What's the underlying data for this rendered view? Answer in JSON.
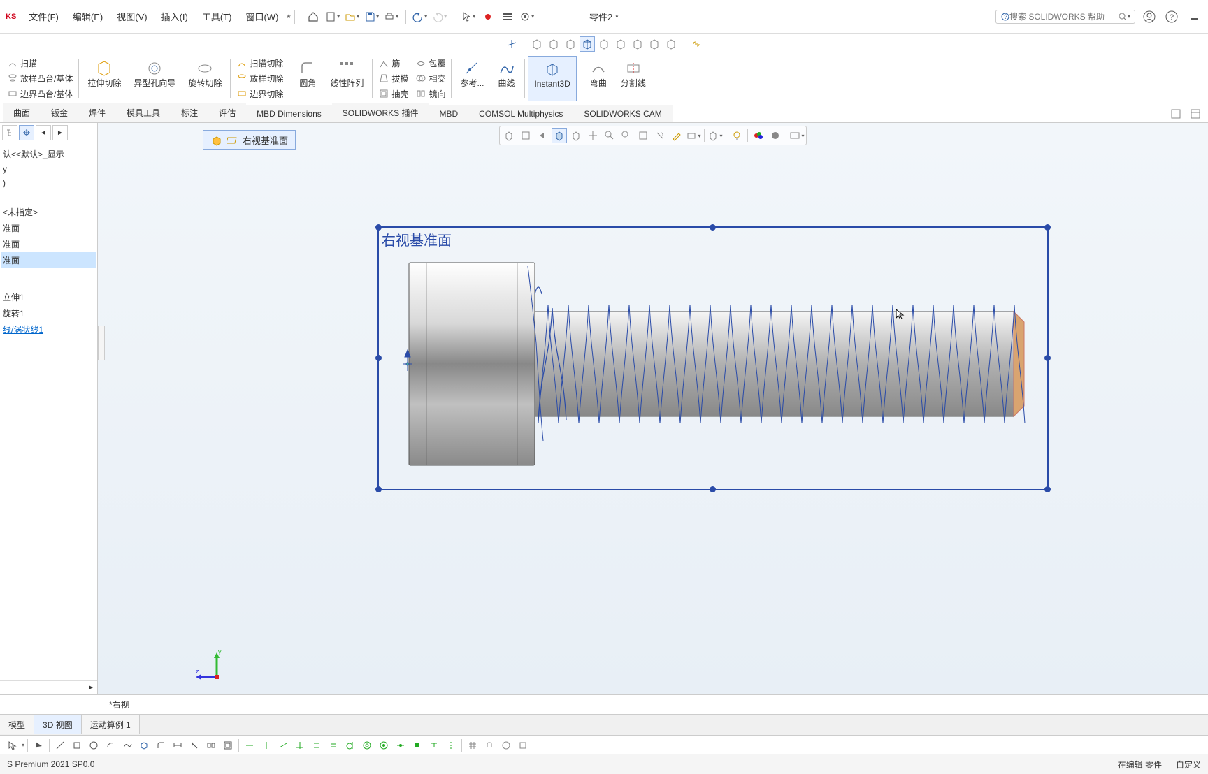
{
  "app_logo_text": "KS",
  "menubar": [
    "文件(F)",
    "编辑(E)",
    "视图(V)",
    "插入(I)",
    "工具(T)",
    "窗口(W)"
  ],
  "doc_title": "零件2 *",
  "search_placeholder": "搜索 SOLIDWORKS 帮助",
  "ribbon": {
    "col1": {
      "sweep": "扫描",
      "loft": "放样凸台/基体",
      "boundary": "边界凸台/基体"
    },
    "col2": {
      "ext": "拉伸切除",
      "hole": "异型孔向导",
      "rev": "旋转切除"
    },
    "col3": {
      "sweep": "扫描切除",
      "loft": "放样切除",
      "boundary": "边界切除"
    },
    "col4": {
      "fillet": "圆角",
      "pattern": "线性阵列"
    },
    "col5": {
      "rib": "筋",
      "draft": "拔模",
      "shell": "抽壳"
    },
    "col6": {
      "wrap": "包覆",
      "int": "相交",
      "mirror": "镜向"
    },
    "refgeo": "参考...",
    "curves": "曲线",
    "instant3d": "Instant3D",
    "bend": "弯曲",
    "split": "分割线"
  },
  "tabs": [
    "曲面",
    "钣金",
    "焊件",
    "模具工具",
    "标注",
    "评估",
    "MBD Dimensions",
    "SOLIDWORKS 插件",
    "MBD",
    "COMSOL Multiphysics",
    "SOLIDWORKS CAM"
  ],
  "breadcrumb": "右视基准面",
  "plane_label": "右视基准面",
  "tree": {
    "config": "认<<默认>_显示",
    "mat": "<未指定>",
    "p1": "准面",
    "p2": "准面",
    "p3": "准面",
    "f1": "立伸1",
    "f2": "旋转1",
    "f3": "线/涡状线1"
  },
  "bottom_view": "*右视",
  "bottom_tabs": [
    "模型",
    "3D 视图",
    "运动算例 1"
  ],
  "status": {
    "version": "S Premium 2021 SP0.0",
    "edit": "在编辑 零件",
    "custom": "自定义"
  },
  "triad": {
    "y": "y",
    "z": "z"
  }
}
